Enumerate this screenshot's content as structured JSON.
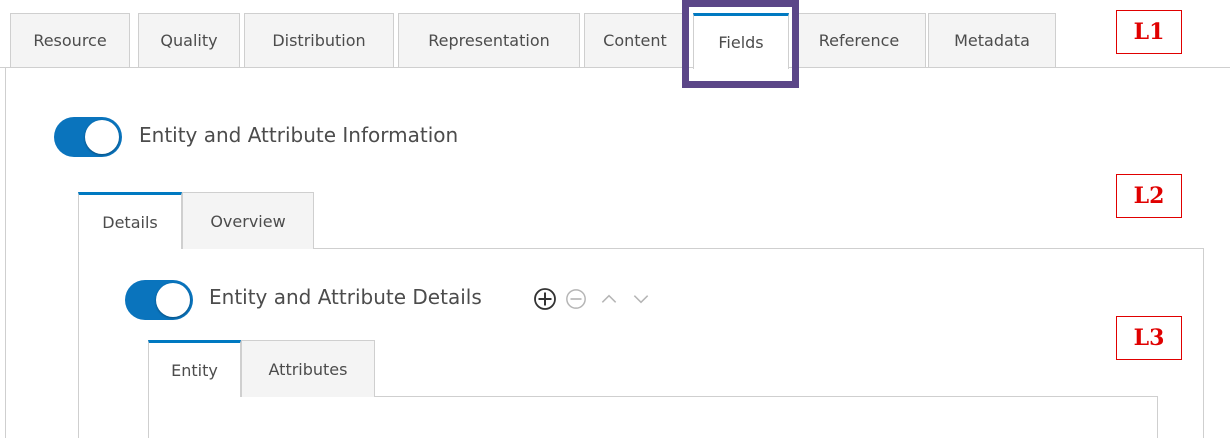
{
  "top_tabs": [
    "Resource",
    "Quality",
    "Distribution",
    "Representation",
    "Content",
    "Fields",
    "Reference",
    "Metadata"
  ],
  "active_top_tab": "Fields",
  "callouts": {
    "l1": "L1",
    "l2": "L2",
    "l3": "L3"
  },
  "section": {
    "label": "Entity and Attribute Information",
    "toggle_on": true
  },
  "level2_tabs": {
    "details": "Details",
    "overview": "Overview",
    "active": "Details"
  },
  "details": {
    "label": "Entity and Attribute Details",
    "toggle_on": true,
    "icons": [
      "add-circle-icon",
      "remove-circle-icon",
      "chevron-up-icon",
      "chevron-down-icon"
    ]
  },
  "level3_tabs": {
    "entity": "Entity",
    "attributes": "Attributes",
    "active": "Entity"
  },
  "colors": {
    "accent": "#0079c1",
    "toggle": "#0a74bd",
    "highlight": "#5b4688",
    "callout": "#e00000"
  }
}
